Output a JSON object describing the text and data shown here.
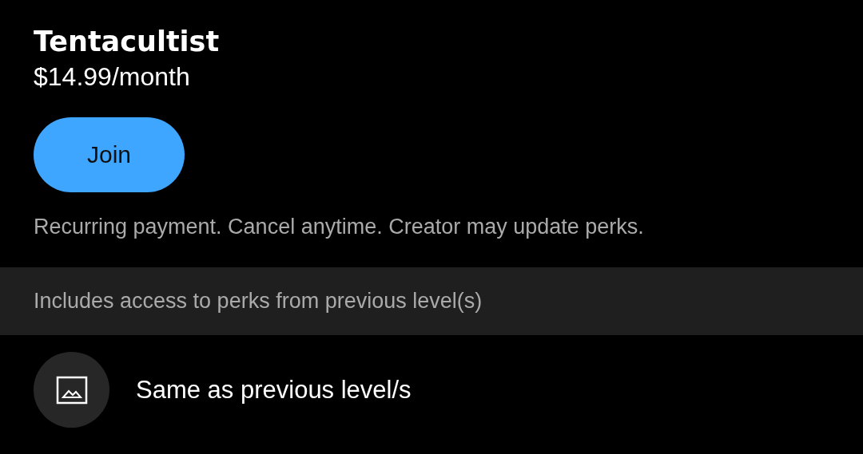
{
  "tier": {
    "name": "Tentacultist",
    "price": "$14.99/month"
  },
  "join_button": {
    "label": "Join"
  },
  "disclaimer": "Recurring payment. Cancel anytime. Creator may update perks.",
  "perks_banner": "Includes access to perks from previous level(s)",
  "perks": [
    {
      "kind": "image",
      "label": "Same as previous level/s"
    }
  ]
}
